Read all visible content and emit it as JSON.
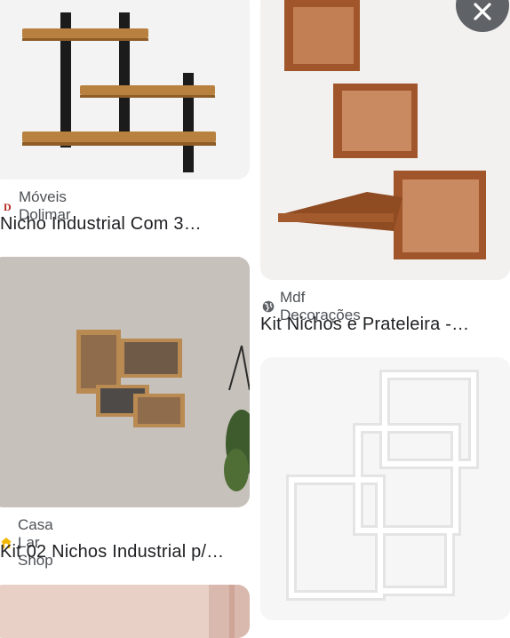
{
  "results": [
    {
      "source": "Móveis Dolimar",
      "title": "Nicho Industrial Com 3…",
      "favicon": "dolimar-logo-icon"
    },
    {
      "source": "Mdf Decorações",
      "title": "Kit Nichos e Prateleira -…",
      "favicon": "globe-icon"
    },
    {
      "source": "Casa Lar Shop",
      "title": "Kit 02 Nichos Industrial p/…",
      "favicon": "house-icon"
    }
  ],
  "close_button": {
    "icon": "close-icon",
    "color": "#5f6368"
  }
}
